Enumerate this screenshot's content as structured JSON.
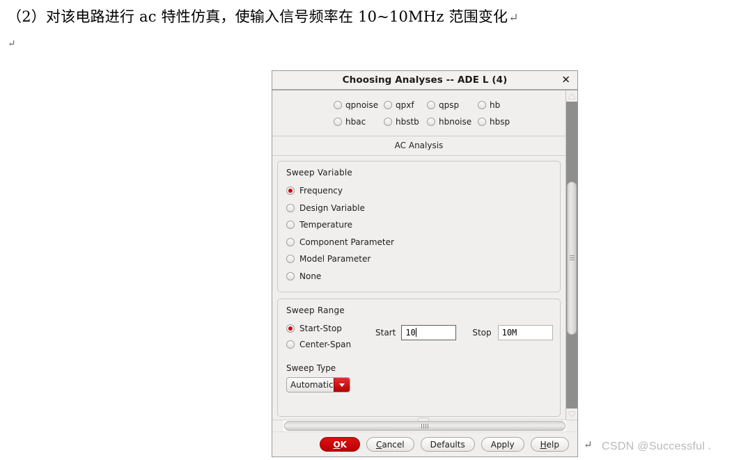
{
  "document": {
    "paragraph_1": "（2）对该电路进行 ac 特性仿真，使输入信号频率在 10~10MHz 范围变化",
    "paragraph_1_mark": "↵",
    "paragraph_2_mark": "↵",
    "trailing_mark": "↵"
  },
  "watermark": {
    "text": "CSDN @Successful",
    "tail": "、"
  },
  "dialog": {
    "title": "Choosing Analyses -- ADE L (4)",
    "close_label": "✕",
    "analyses": {
      "row1": [
        {
          "label": "qpnoise",
          "selected": false
        },
        {
          "label": "qpxf",
          "selected": false
        },
        {
          "label": "qpsp",
          "selected": false
        },
        {
          "label": "hb",
          "selected": false
        }
      ],
      "row2": [
        {
          "label": "hbac",
          "selected": false
        },
        {
          "label": "hbstb",
          "selected": false
        },
        {
          "label": "hbnoise",
          "selected": false
        },
        {
          "label": "hbsp",
          "selected": false
        }
      ]
    },
    "analysis_band_title": "AC Analysis",
    "sweep_variable": {
      "group_title": "Sweep Variable",
      "options": [
        {
          "label": "Frequency",
          "selected": true
        },
        {
          "label": "Design Variable",
          "selected": false
        },
        {
          "label": "Temperature",
          "selected": false
        },
        {
          "label": "Component Parameter",
          "selected": false
        },
        {
          "label": "Model Parameter",
          "selected": false
        },
        {
          "label": "None",
          "selected": false
        }
      ]
    },
    "sweep_range": {
      "group_title": "Sweep Range",
      "modes": [
        {
          "label": "Start-Stop",
          "selected": true
        },
        {
          "label": "Center-Span",
          "selected": false
        }
      ],
      "start_label": "Start",
      "start_value": "10",
      "stop_label": "Stop",
      "stop_value": "10M",
      "sweep_type_label": "Sweep Type",
      "sweep_type_value": "Automatic"
    },
    "buttons": {
      "ok": "OK",
      "ok_mnemonic": "O",
      "ok_rest": "K",
      "cancel_mnemonic": "C",
      "cancel_rest": "ancel",
      "defaults": "Defaults",
      "apply": "Apply",
      "help_mnemonic": "H",
      "help_rest": "elp"
    }
  },
  "colors": {
    "accent_red": "#c40000",
    "dialog_bg": "#f0efee",
    "scrollbar_track": "#8e8e8e"
  }
}
